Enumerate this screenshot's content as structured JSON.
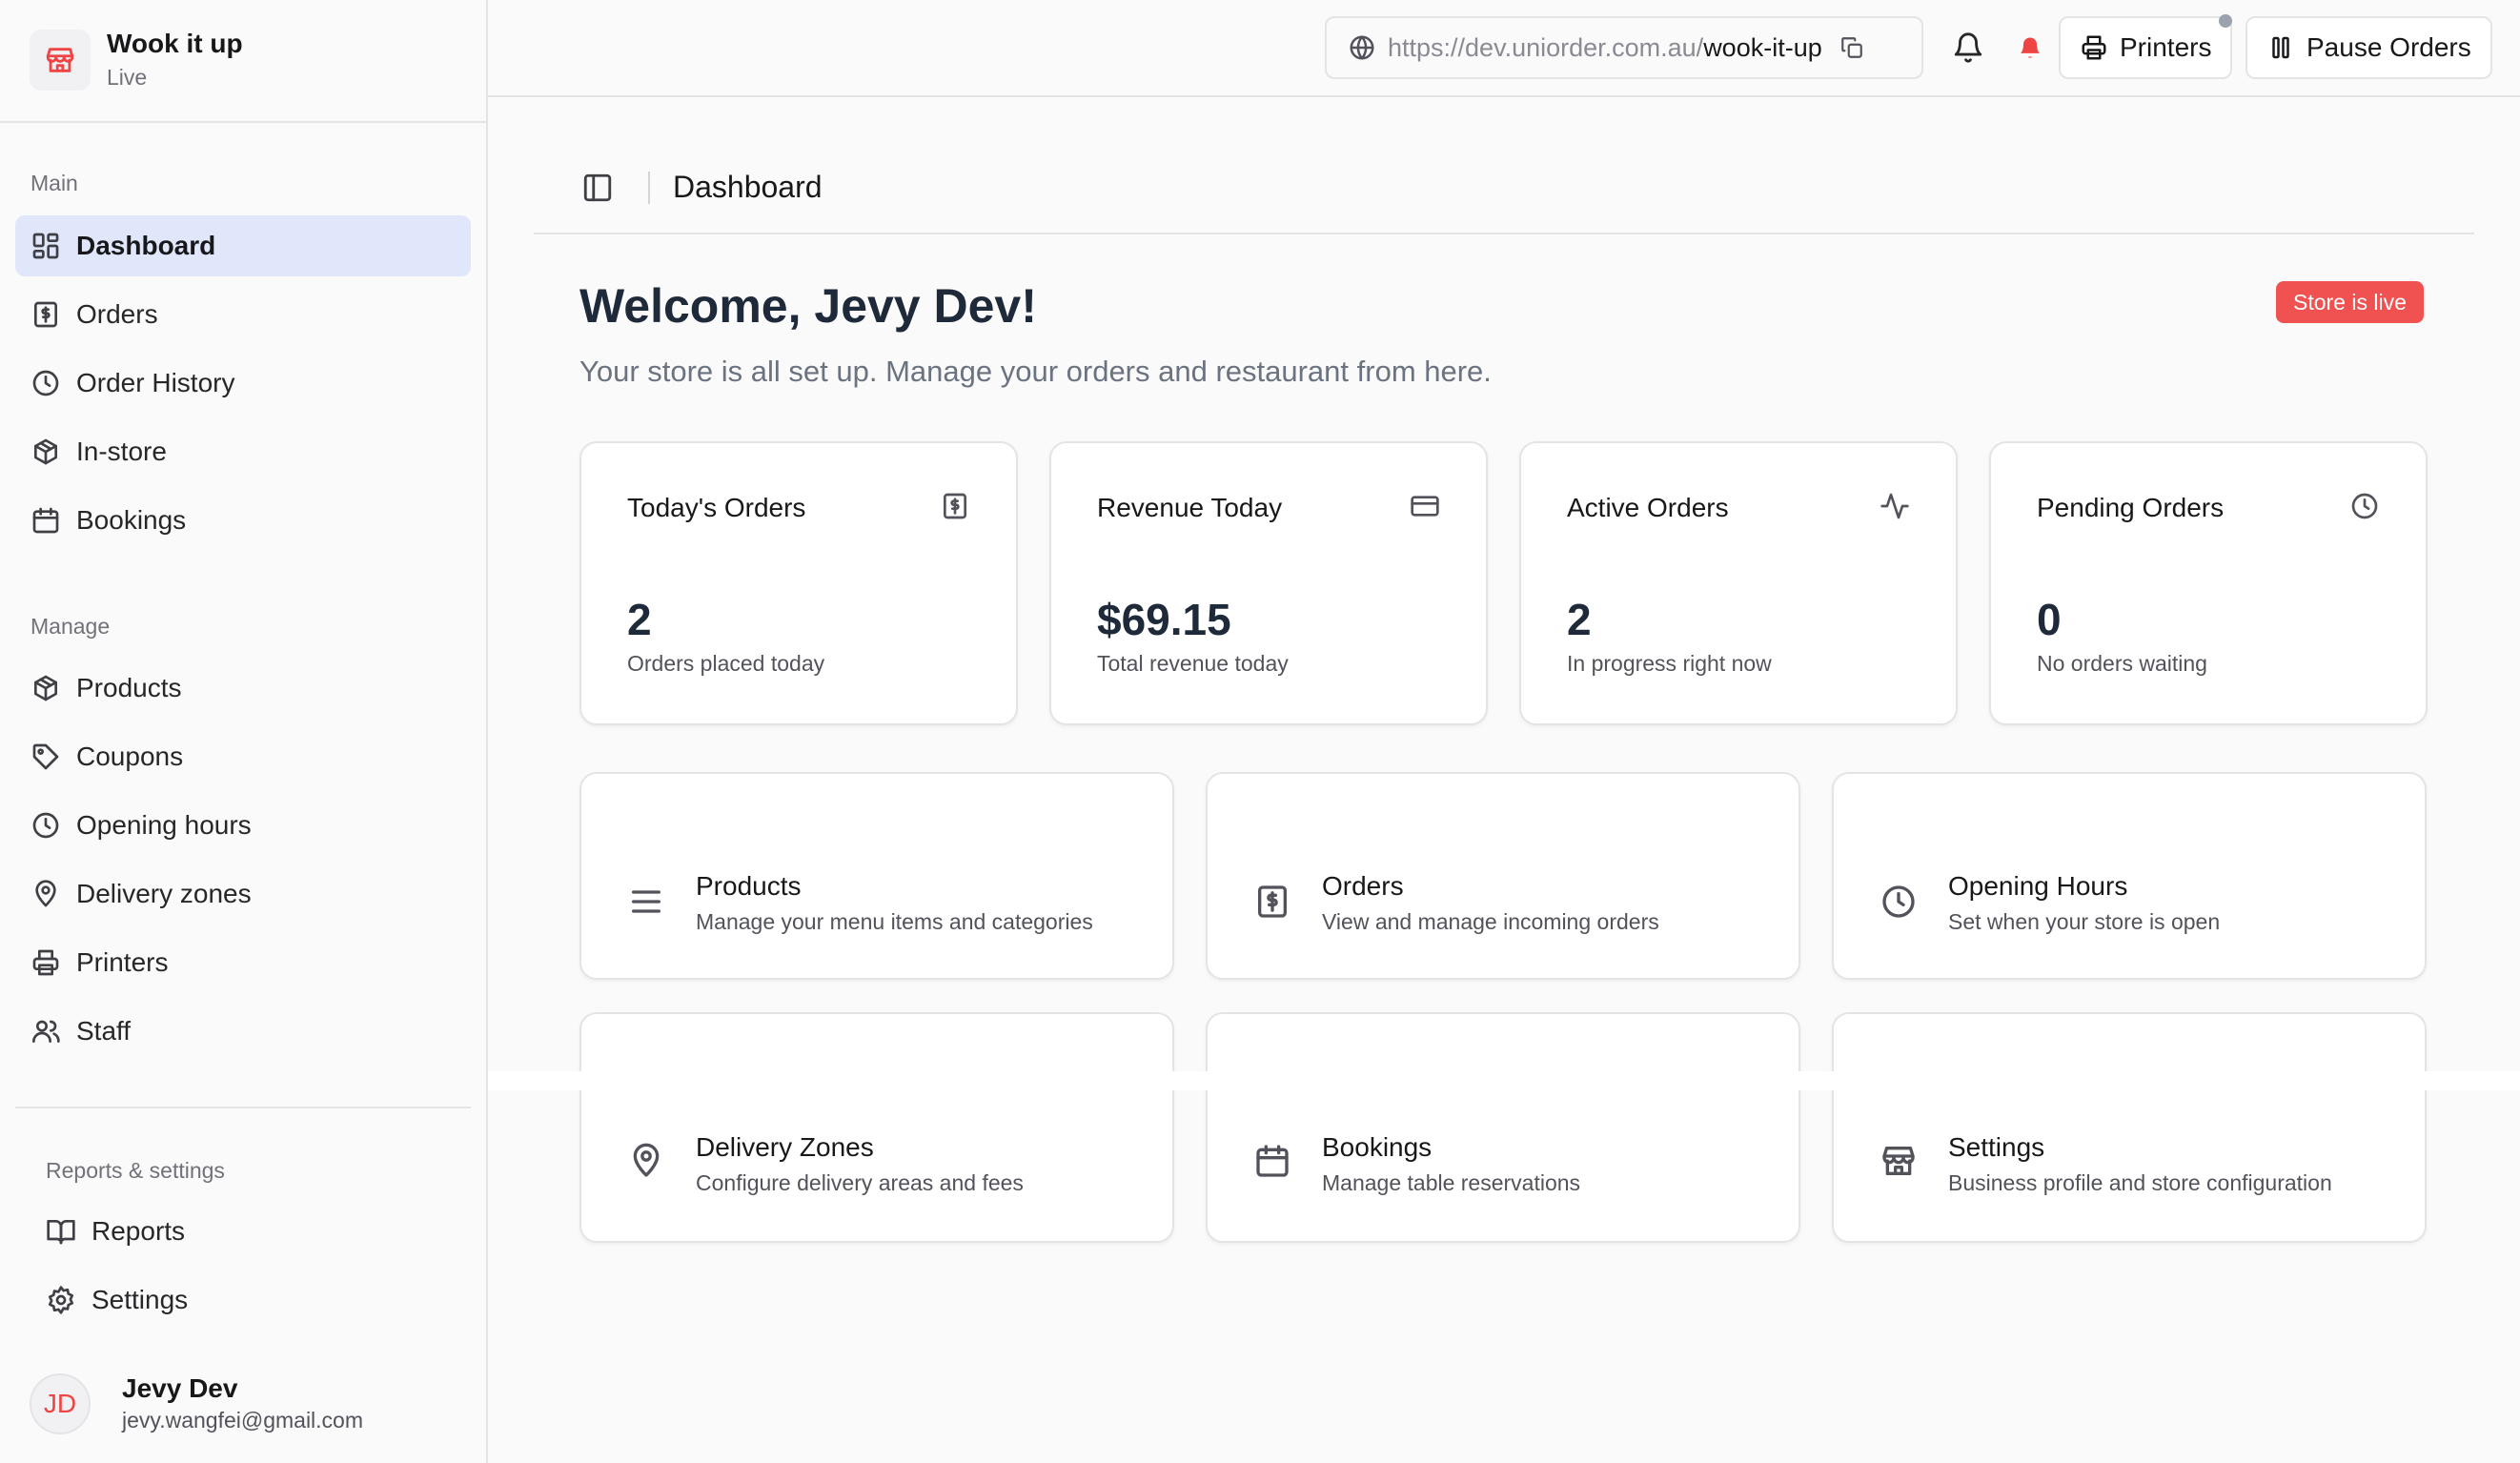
{
  "store": {
    "name": "Wook it up",
    "status": "Live",
    "logo_icon": "store-icon",
    "accent": "#ef4444"
  },
  "sidebar": {
    "main_label": "Main",
    "main_items": [
      {
        "label": "Dashboard",
        "icon": "dashboard-icon",
        "active": true
      },
      {
        "label": "Orders",
        "icon": "receipt-icon"
      },
      {
        "label": "Order History",
        "icon": "clock-icon"
      },
      {
        "label": "In-store",
        "icon": "package-icon"
      },
      {
        "label": "Bookings",
        "icon": "calendar-icon"
      }
    ],
    "manage_label": "Manage",
    "manage_items": [
      {
        "label": "Products",
        "icon": "package-icon"
      },
      {
        "label": "Coupons",
        "icon": "tag-icon"
      },
      {
        "label": "Opening hours",
        "icon": "clock-icon"
      },
      {
        "label": "Delivery zones",
        "icon": "map-pin-icon"
      },
      {
        "label": "Printers",
        "icon": "printer-icon"
      },
      {
        "label": "Staff",
        "icon": "users-icon"
      }
    ],
    "reports_label": "Reports & settings",
    "reports_items": [
      {
        "label": "Reports",
        "icon": "book-icon"
      },
      {
        "label": "Settings",
        "icon": "gear-icon"
      }
    ]
  },
  "user": {
    "initials": "JD",
    "name": "Jevy Dev",
    "email": "jevy.wangfei@gmail.com"
  },
  "topbar": {
    "url_prefix": "https://dev.uniorder.com.au/",
    "url_slug": "wook-it-up",
    "printers_label": "Printers",
    "pause_label": "Pause Orders"
  },
  "page": {
    "breadcrumb": "Dashboard",
    "welcome": "Welcome, Jevy Dev!",
    "subtitle": "Your store is all set up. Manage your orders and restaurant from here.",
    "badge": "Store is live",
    "badge_color": "#f05252"
  },
  "stats": [
    {
      "title": "Today's Orders",
      "value": "2",
      "sub": "Orders placed today",
      "icon": "receipt-icon"
    },
    {
      "title": "Revenue Today",
      "value": "$69.15",
      "sub": "Total revenue today",
      "icon": "credit-card-icon"
    },
    {
      "title": "Active Orders",
      "value": "2",
      "sub": "In progress right now",
      "icon": "activity-icon"
    },
    {
      "title": "Pending Orders",
      "value": "0",
      "sub": "No orders waiting",
      "icon": "clock-icon"
    }
  ],
  "quick_links": [
    {
      "title": "Products",
      "desc": "Manage your menu items and categories",
      "icon": "menu-icon"
    },
    {
      "title": "Orders",
      "desc": "View and manage incoming orders",
      "icon": "receipt-icon"
    },
    {
      "title": "Opening Hours",
      "desc": "Set when your store is open",
      "icon": "clock-icon"
    },
    {
      "title": "Delivery Zones",
      "desc": "Configure delivery areas and fees",
      "icon": "map-pin-icon"
    },
    {
      "title": "Bookings",
      "desc": "Manage table reservations",
      "icon": "calendar-icon"
    },
    {
      "title": "Settings",
      "desc": "Business profile and store configuration",
      "icon": "store-icon"
    }
  ]
}
